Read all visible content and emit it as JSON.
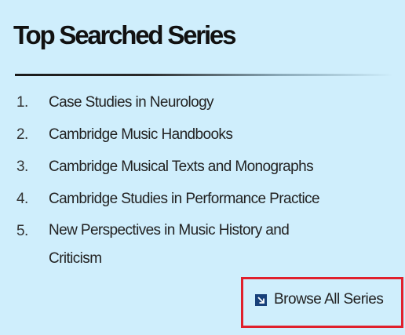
{
  "panel": {
    "title": "Top Searched Series",
    "items": [
      {
        "number": "1.",
        "label": "Case Studies in Neurology"
      },
      {
        "number": "2.",
        "label": "Cambridge Music Handbooks"
      },
      {
        "number": "3.",
        "label": "Cambridge Musical Texts and Monographs"
      },
      {
        "number": "4.",
        "label": "Cambridge Studies in Performance Practice"
      },
      {
        "number": "5.",
        "label": "New Perspectives in Music History and Criticism"
      }
    ],
    "browse": {
      "label": "Browse All Series",
      "icon": "arrow-down-right-icon"
    },
    "colors": {
      "background": "#cfeefc",
      "highlight_border": "#e0202c",
      "icon_fill": "#17407a"
    }
  }
}
